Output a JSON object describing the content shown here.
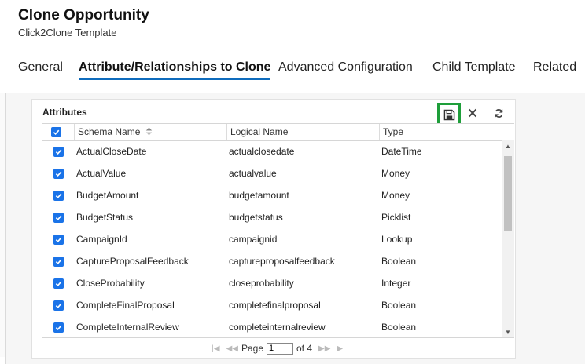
{
  "header": {
    "title": "Clone Opportunity",
    "subtitle": "Click2Clone Template"
  },
  "tabs": [
    {
      "label": "General"
    },
    {
      "label": "Attribute/Relationships to Clone",
      "active": true
    },
    {
      "label": "Advanced Configuration"
    },
    {
      "label": "Child Template"
    },
    {
      "label": "Related"
    }
  ],
  "grid": {
    "title": "Attributes",
    "toolbar": {
      "save_icon": "save-icon",
      "close_icon": "close-icon",
      "refresh_icon": "refresh-icon"
    },
    "columns": [
      "Schema Name",
      "Logical Name",
      "Type"
    ],
    "sort_column": "Schema Name",
    "header_checked": true,
    "rows": [
      {
        "checked": true,
        "schema": "ActualCloseDate",
        "logical": "actualclosedate",
        "type": "DateTime"
      },
      {
        "checked": true,
        "schema": "ActualValue",
        "logical": "actualvalue",
        "type": "Money"
      },
      {
        "checked": true,
        "schema": "BudgetAmount",
        "logical": "budgetamount",
        "type": "Money"
      },
      {
        "checked": true,
        "schema": "BudgetStatus",
        "logical": "budgetstatus",
        "type": "Picklist"
      },
      {
        "checked": true,
        "schema": "CampaignId",
        "logical": "campaignid",
        "type": "Lookup"
      },
      {
        "checked": true,
        "schema": "CaptureProposalFeedback",
        "logical": "captureproposalfeedback",
        "type": "Boolean"
      },
      {
        "checked": true,
        "schema": "CloseProbability",
        "logical": "closeprobability",
        "type": "Integer"
      },
      {
        "checked": true,
        "schema": "CompleteFinalProposal",
        "logical": "completefinalproposal",
        "type": "Boolean"
      },
      {
        "checked": true,
        "schema": "CompleteInternalReview",
        "logical": "completeinternalreview",
        "type": "Boolean"
      }
    ],
    "pager": {
      "page_label": "Page",
      "current_page": "1",
      "of_label": "of 4"
    }
  },
  "colors": {
    "accent": "#0f6cbd",
    "checkbox": "#1a73e8",
    "save_highlight": "#1e9e3a"
  }
}
